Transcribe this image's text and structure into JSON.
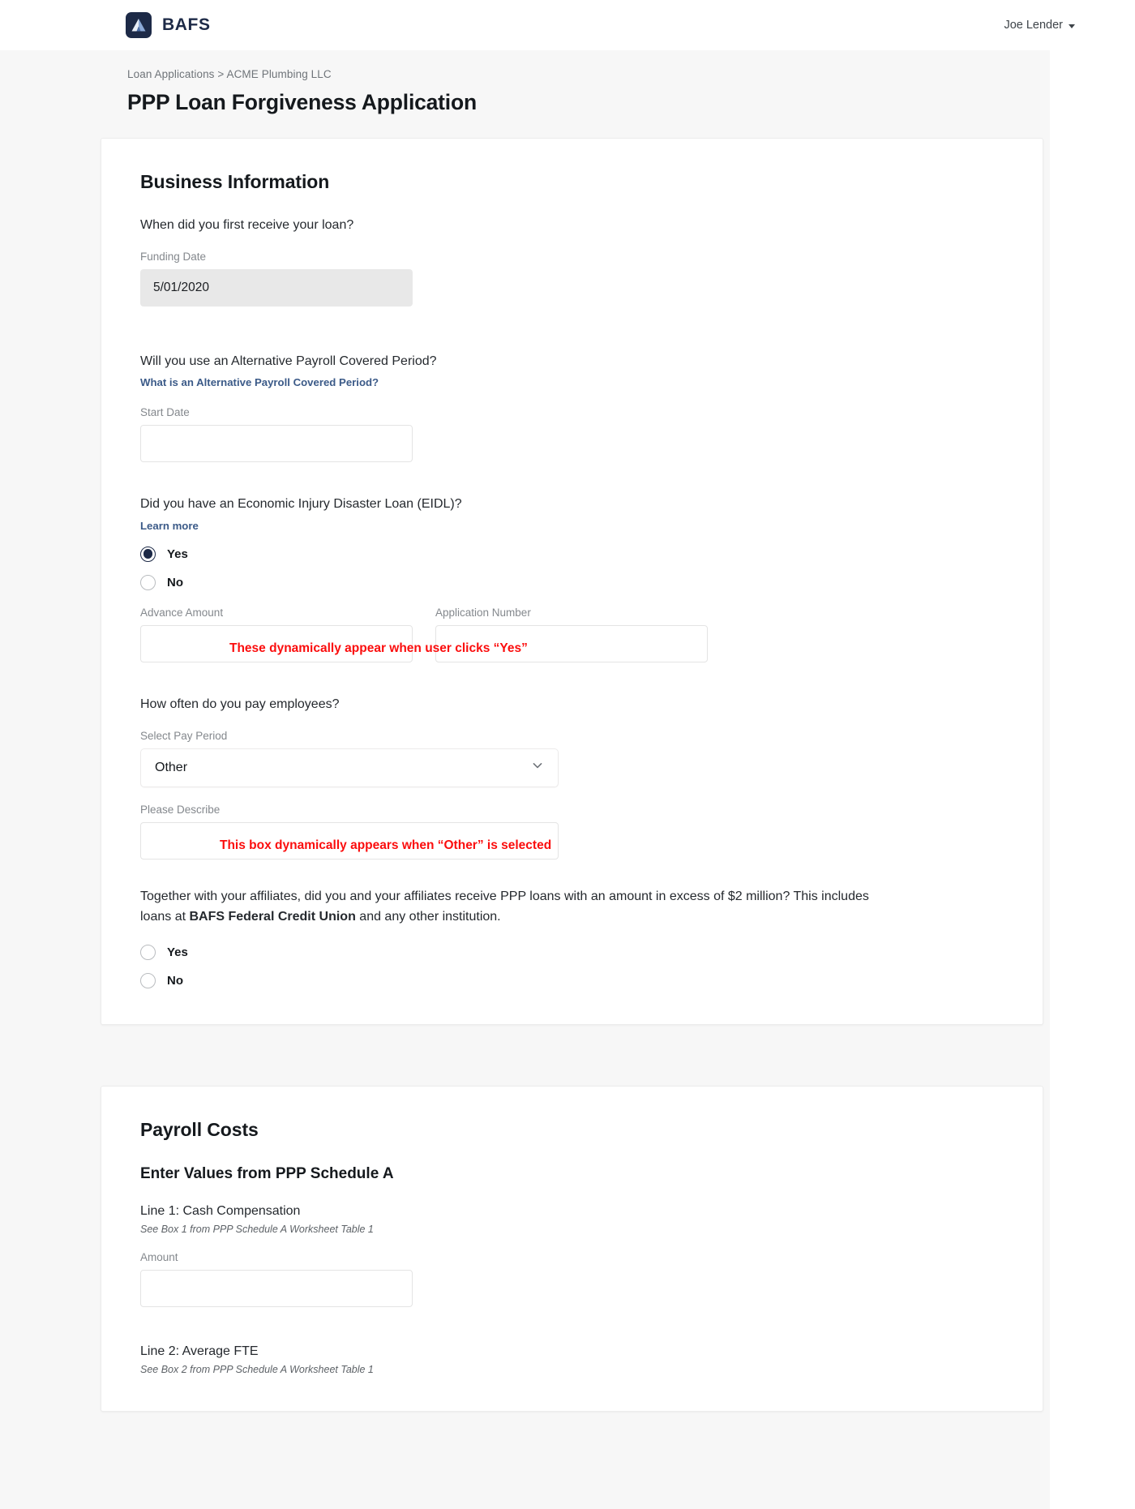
{
  "header": {
    "brand_name": "BAFS",
    "brand_icon": "bafs-mountain-logo",
    "user_name": "Joe Lender",
    "user_caret_icon": "chevron-down-icon"
  },
  "breadcrumb": {
    "text": "Loan Applications > ACME Plumbing LLC",
    "parent": "Loan Applications",
    "current": "ACME Plumbing LLC"
  },
  "page_title": "PPP Loan Forgiveness Application",
  "business_information": {
    "section_title": "Business Information",
    "funding": {
      "question": "When did you first receive your loan?",
      "field_label": "Funding Date",
      "value": "5/01/2020"
    },
    "alt_payroll": {
      "question": "Will you use an Alternative Payroll Covered Period?",
      "help_link": "What is an Alternative Payroll Covered Period?",
      "field_label": "Start Date",
      "value": "",
      "placeholder": ""
    },
    "eidl": {
      "question": "Did you have an Economic Injury Disaster Loan (EIDL)?",
      "help_link": "Learn more",
      "options": [
        {
          "label": "Yes",
          "checked": true
        },
        {
          "label": "No",
          "checked": false
        }
      ],
      "advance_amount_label": "Advance Amount",
      "advance_amount_value": "",
      "application_number_label": "Application Number",
      "application_number_value": "",
      "annotation": "These dynamically appear when user clicks “Yes”"
    },
    "pay_period": {
      "question": "How often do you pay employees?",
      "field_label": "Select Pay Period",
      "selected": "Other",
      "chevron_icon": "chevron-down-icon",
      "describe_label": "Please Describe",
      "describe_value": "",
      "annotation": "This box dynamically appears when “Other” is selected"
    },
    "affiliates": {
      "text_part1": "Together with your affiliates, did you and your affiliates receive PPP loans with an amount in excess of $2 million? This includes loans at ",
      "bold_part": "BAFS Federal Credit Union",
      "text_part2": " and any other institution.",
      "options": [
        {
          "label": "Yes",
          "checked": false
        },
        {
          "label": "No",
          "checked": false
        }
      ]
    }
  },
  "payroll_costs": {
    "section_title": "Payroll Costs",
    "sub_title": "Enter Values from PPP Schedule A",
    "line1": {
      "title": "Line 1: Cash Compensation",
      "note": "See Box 1 from PPP Schedule A Worksheet Table 1",
      "field_label": "Amount",
      "value": ""
    },
    "line2": {
      "title": "Line 2: Average FTE",
      "note": "See Box 2 from PPP Schedule A Worksheet Table 1"
    }
  },
  "colors": {
    "brand_navy": "#1d2a47",
    "link_blue": "#3b5a88",
    "annotation_red": "#fb0d0d",
    "page_bg": "#f7f7f7",
    "card_bg": "#ffffff",
    "filled_input_bg": "#e8e8e8"
  }
}
